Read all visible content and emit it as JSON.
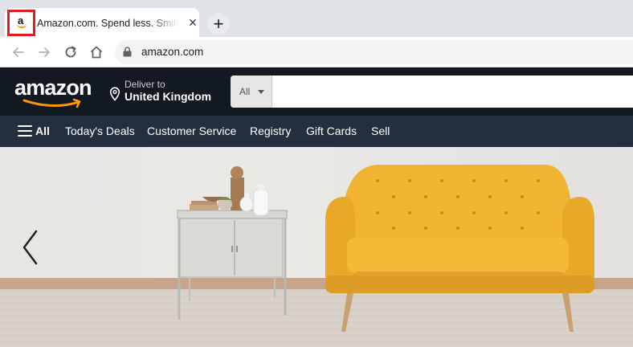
{
  "browser": {
    "tab_title": "Amazon.com. Spend less. Smile more.",
    "tab_close": "✕",
    "new_tab": "+",
    "url": "amazon.com"
  },
  "header": {
    "logo_text": "amazon",
    "deliver_line1": "Deliver to",
    "deliver_line2": "United Kingdom",
    "search_category": "All",
    "search_placeholder": "",
    "colors": {
      "nav_bg": "#131921",
      "subnav_bg": "#232f3e",
      "accent": "#ff9900"
    }
  },
  "subnav": {
    "all": "All",
    "items": [
      "Today's Deals",
      "Customer Service",
      "Registry",
      "Gift Cards",
      "Sell"
    ]
  },
  "hero": {
    "prev_icon": "chevron-left-icon"
  }
}
